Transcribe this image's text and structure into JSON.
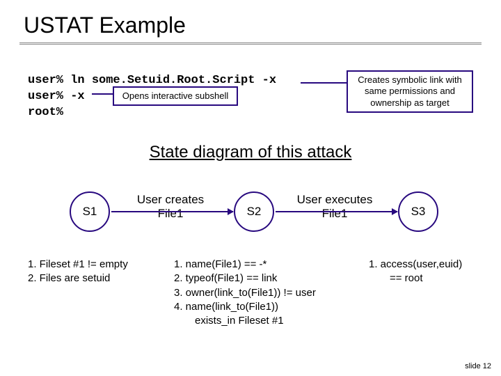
{
  "title": "USTAT Example",
  "code": {
    "line1": "user% ln some.Setuid.Root.Script -x",
    "line2": "user% -x",
    "line3": "root%"
  },
  "callouts": {
    "subshell": "Opens interactive subshell",
    "symlink": "Creates symbolic link with same permissions and ownership as target"
  },
  "heading": "State diagram of this attack",
  "states": {
    "s1": "S1",
    "s2": "S2",
    "s3": "S3"
  },
  "transitions": {
    "t1_l1": "User creates",
    "t1_l2": "File1",
    "t2_l1": "User executes",
    "t2_l2": "File1"
  },
  "conditions": {
    "c1_l1": "1. Fileset #1 != empty",
    "c1_l2": "2. Files are setuid",
    "c2_l1": "1. name(File1) == -*",
    "c2_l2": "2. typeof(File1) == link",
    "c2_l3": "3. owner(link_to(File1)) != user",
    "c2_l4": "4. name(link_to(File1))",
    "c2_l5": "  exists_in Fileset #1",
    "c3_l1": "1. access(user,euid)",
    "c3_l2": "  == root"
  },
  "footer": "slide 12"
}
